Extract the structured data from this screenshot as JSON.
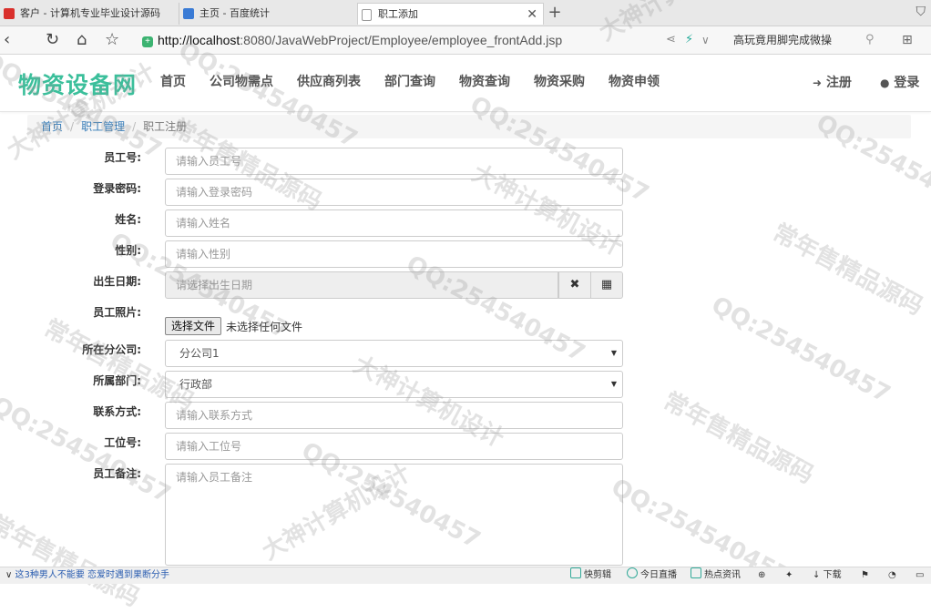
{
  "browser": {
    "tabs": [
      {
        "title": "客户 - 计算机专业毕业设计源码"
      },
      {
        "title": "主页 - 百度统计"
      },
      {
        "title": "职工添加"
      }
    ],
    "new_tab": "+",
    "url_host": "http://localhost",
    "url_rest": ":8080/JavaWebProject/Employee/employee_frontAdd.jsp",
    "search_text": "高玩竟用脚完成微操"
  },
  "site": {
    "logo": "物资设备网",
    "nav": [
      "首页",
      "公司物需点",
      "供应商列表",
      "部门查询",
      "物资查询",
      "物资采购",
      "物资申领"
    ],
    "register": "注册",
    "login": "登录"
  },
  "breadcrumb": {
    "home": "首页",
    "section": "职工管理",
    "current": "职工注册"
  },
  "form": {
    "employee_no": {
      "label": "员工号:",
      "placeholder": "请输入员工号"
    },
    "password": {
      "label": "登录密码:",
      "placeholder": "请输入登录密码"
    },
    "name": {
      "label": "姓名:",
      "placeholder": "请输入姓名"
    },
    "gender": {
      "label": "性别:",
      "placeholder": "请输入性别"
    },
    "birth_date": {
      "label": "出生日期:",
      "placeholder": "请选择出生日期"
    },
    "photo": {
      "label": "员工照片:",
      "button": "选择文件",
      "status": "未选择任何文件"
    },
    "branch": {
      "label": "所在分公司:",
      "value": "分公司1"
    },
    "department": {
      "label": "所属部门:",
      "value": "行政部"
    },
    "contact": {
      "label": "联系方式:",
      "placeholder": "请输入联系方式"
    },
    "seat_no": {
      "label": "工位号:",
      "placeholder": "请输入工位号"
    },
    "remark": {
      "label": "员工备注:",
      "placeholder": "请输入员工备注"
    }
  },
  "statusbar": {
    "news": "这3种男人不能要 恋爱时遇到果断分手",
    "items": [
      "快剪辑",
      "今日直播",
      "热点资讯",
      "下载"
    ]
  },
  "watermarks": [
    "大神计算机设计",
    "QQ:254540457",
    "常年售精品源码"
  ]
}
